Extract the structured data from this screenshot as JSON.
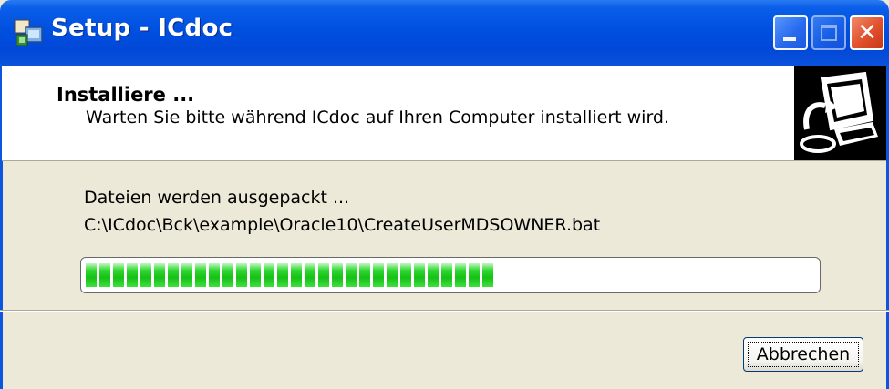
{
  "window": {
    "title": "Setup - ICdoc"
  },
  "titlebar": {
    "minimize_icon": "minimize-icon",
    "maximize_icon": "maximize-icon",
    "close_icon": "close-icon"
  },
  "header": {
    "title": "Installiere ...",
    "subtitle": "Warten Sie bitte während ICdoc auf Ihren Computer installiert wird.",
    "image_icon": "computer-install-icon"
  },
  "progress": {
    "status_text": "Dateien werden ausgepackt ...",
    "current_file": "C:\\ICdoc\\Bck\\example\\Oracle10\\CreateUserMDSOWNER.bat",
    "fraction": 0.56,
    "color": "#22cc22"
  },
  "buttons": {
    "cancel_label": "Abbrechen"
  },
  "colors": {
    "titlebar": "#0050e0",
    "background": "#ECE9D8",
    "close_button": "#e0502c"
  }
}
